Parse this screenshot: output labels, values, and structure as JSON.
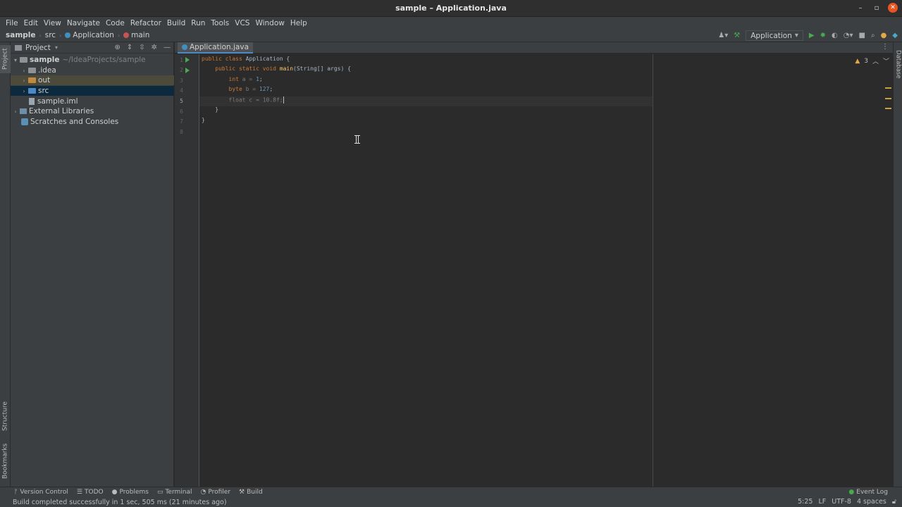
{
  "window": {
    "title": "sample – Application.java"
  },
  "menu": [
    "File",
    "Edit",
    "View",
    "Navigate",
    "Code",
    "Refactor",
    "Build",
    "Run",
    "Tools",
    "VCS",
    "Window",
    "Help"
  ],
  "breadcrumb": {
    "project": "sample",
    "folder": "src",
    "cls": "Application",
    "method": "main"
  },
  "run_config": {
    "label": "Application"
  },
  "left_tabs": {
    "project": "Project",
    "structure": "Structure",
    "bookmarks": "Bookmarks"
  },
  "right_tabs": {
    "database": "Database"
  },
  "project_panel": {
    "title": "Project",
    "tree": {
      "root": "sample",
      "root_path": "~/IdeaProjects/sample",
      "idea": ".idea",
      "out": "out",
      "src": "src",
      "iml": "sample.iml",
      "ext": "External Libraries",
      "scratch": "Scratches and Consoles"
    }
  },
  "editor": {
    "tab": "Application.java",
    "warnings": "3",
    "line_numbers": [
      "1",
      "2",
      "3",
      "4",
      "5",
      "6",
      "7",
      "8"
    ],
    "code": {
      "l1_kw": "public class ",
      "l1_rest": "Application {",
      "l2_kw": "    public static void ",
      "l2_fn": "main",
      "l2_rest": "(String[] args) {",
      "l3_kw": "        int ",
      "l3_rest": "a = ",
      "l3_num": "1",
      "l3_end": ";",
      "l4_kw": "        byte ",
      "l4_rest": "b = ",
      "l4_num": "127",
      "l4_end": ";",
      "l5_text": "        float c = 10.8f;",
      "l6": "    }",
      "l7": "}"
    }
  },
  "bottom_tools": [
    "Version Control",
    "TODO",
    "Problems",
    "Terminal",
    "Profiler",
    "Build"
  ],
  "event_log": "Event Log",
  "status": {
    "message": "Build completed successfully in 1 sec, 505 ms (21 minutes ago)",
    "position": "5:25",
    "line_sep": "LF",
    "encoding": "UTF-8",
    "indent": "4 spaces"
  }
}
